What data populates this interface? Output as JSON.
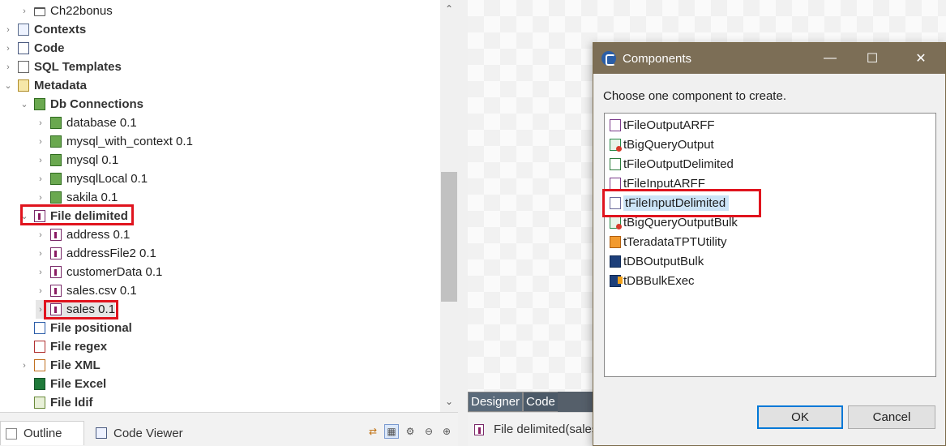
{
  "tree": {
    "items": [
      {
        "label": "Ch22bonus",
        "expanded": false
      },
      {
        "label": "Contexts",
        "expanded": false
      },
      {
        "label": "Code",
        "expanded": false
      },
      {
        "label": "SQL Templates",
        "expanded": false
      },
      {
        "label": "Metadata",
        "expanded": true
      },
      {
        "label": "Db Connections",
        "expanded": true
      },
      {
        "label": "database 0.1",
        "expanded": false
      },
      {
        "label": "mysql_with_context 0.1",
        "expanded": false
      },
      {
        "label": "mysql 0.1",
        "expanded": false
      },
      {
        "label": "mysqlLocal 0.1",
        "expanded": false
      },
      {
        "label": "sakila 0.1",
        "expanded": false
      },
      {
        "label": "File delimited",
        "expanded": true
      },
      {
        "label": "address 0.1",
        "expanded": false
      },
      {
        "label": "addressFile2 0.1",
        "expanded": false
      },
      {
        "label": "customerData 0.1",
        "expanded": false
      },
      {
        "label": "sales.csv 0.1",
        "expanded": false
      },
      {
        "label": "sales 0.1",
        "expanded": false
      },
      {
        "label": "File positional",
        "expanded": false
      },
      {
        "label": "File regex",
        "expanded": false
      },
      {
        "label": "File XML",
        "expanded": false
      },
      {
        "label": "File Excel",
        "expanded": false
      },
      {
        "label": "File ldif",
        "expanded": false
      }
    ]
  },
  "bottom_tabs": {
    "outline": "Outline",
    "code_viewer": "Code Viewer"
  },
  "canvas_tabs": {
    "designer": "Designer",
    "code": "Code"
  },
  "status": {
    "text": "File delimited(sales"
  },
  "dialog": {
    "title": "Components",
    "prompt": "Choose one component to create.",
    "components": [
      {
        "label": "tFileOutputARFF",
        "icon": "file-output-arff-icon"
      },
      {
        "label": "tBigQueryOutput",
        "icon": "bigquery-output-icon"
      },
      {
        "label": "tFileOutputDelimited",
        "icon": "file-output-delimited-icon"
      },
      {
        "label": "tFileInputARFF",
        "icon": "file-input-arff-icon"
      },
      {
        "label": "tFileInputDelimited",
        "icon": "file-input-delimited-icon",
        "selected": true
      },
      {
        "label": "tBigQueryOutputBulk",
        "icon": "bigquery-output-bulk-icon"
      },
      {
        "label": "tTeradataTPTUtility",
        "icon": "teradata-icon"
      },
      {
        "label": "tDBOutputBulk",
        "icon": "db-output-bulk-icon"
      },
      {
        "label": "tDBBulkExec",
        "icon": "db-bulk-exec-icon"
      }
    ],
    "ok_label": "OK",
    "cancel_label": "Cancel",
    "minimize_glyph": "—",
    "maximize_glyph": "☐",
    "close_glyph": "✕"
  },
  "colors": {
    "highlight_border": "#e0141e",
    "dialog_titlebar": "#7c6e56",
    "selection": "#cce4f7"
  }
}
